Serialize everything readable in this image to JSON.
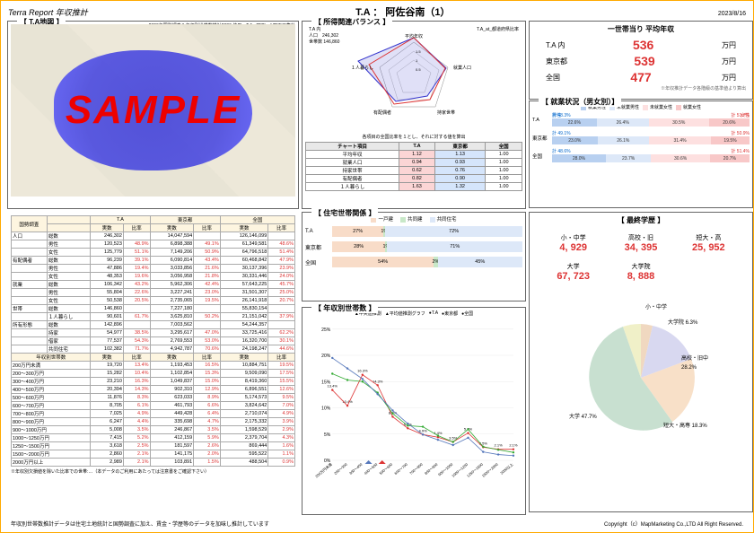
{
  "header": {
    "left": "Terra Report 年収推計",
    "title": "T.A ： 阿佐谷南（1）",
    "date": "2023/8/16"
  },
  "map": {
    "title": "【 T.A地図 】",
    "note": "2020年国勢調査＆年収別世帯数推計2020 使用　T.A : 円[2km] 町丁目集計",
    "sample": "SAMPLE"
  },
  "balance": {
    "title": "【 所得関連バランス 】",
    "meta1": "各項目…",
    "meta2": "人口　246,302",
    "meta3": "世帯数 146,860",
    "meta4": "T.A 内",
    "legend": "T.A_at_都道府県比率",
    "axes": [
      "平均年収",
      "就業人口",
      "持家世帯",
      "有配偶者",
      "１人暮らし"
    ],
    "note": "各項目の全国比率を１とし、それに対する値を算出",
    "table_head": [
      "チャート項目",
      "T.A",
      "東京都",
      "全国"
    ],
    "rows": [
      {
        "k": "平均年収",
        "a": "1.12",
        "b": "1.13",
        "c": "1.00"
      },
      {
        "k": "就業人口",
        "a": "0.94",
        "b": "0.93",
        "c": "1.00"
      },
      {
        "k": "持家世帯",
        "a": "0.62",
        "b": "0.76",
        "c": "1.00"
      },
      {
        "k": "有配偶者",
        "a": "0.82",
        "b": "0.90",
        "c": "1.00"
      },
      {
        "k": "１人暮らし",
        "a": "1.63",
        "b": "1.32",
        "c": "1.00"
      }
    ]
  },
  "income": {
    "title": "一世帯当り 平均年収",
    "rows": [
      {
        "lbl": "T.A 内",
        "val": "536",
        "u": "万円"
      },
      {
        "lbl": "東京都",
        "val": "539",
        "u": "万円"
      },
      {
        "lbl": "全国",
        "val": "477",
        "u": "万円"
      }
    ],
    "note": "※年収推計データ各階級の基準値より算出"
  },
  "emp": {
    "title": "【 就業状況（男女別）】",
    "legend": [
      "就業男性",
      "未就業男性",
      "未就業女性",
      "就業女性"
    ],
    "rows": [
      {
        "area": "T.A",
        "m": "計 48.3%",
        "f": "計 51.7%",
        "vals": [
          "22.6%",
          "26.4%",
          "30.5%",
          "20.6%"
        ]
      },
      {
        "area": "東京都",
        "m": "計 49.1%",
        "f": "計 50.9%",
        "vals": [
          "23.0%",
          "26.1%",
          "31.4%",
          "19.5%"
        ]
      },
      {
        "area": "全国",
        "m": "計 48.6%",
        "f": "計 51.4%",
        "vals": [
          "28.0%",
          "23.7%",
          "30.6%",
          "20.7%"
        ]
      }
    ],
    "hdrs": [
      "男性",
      "女性"
    ]
  },
  "census": {
    "sec1": "国勢調査",
    "sec2": "年収別世帯数",
    "head": [
      "",
      "",
      "T.A",
      "",
      "東京都",
      "",
      "全国",
      ""
    ],
    "head2": [
      "",
      "",
      "実数",
      "比率",
      "実数",
      "比率",
      "実数",
      "比率"
    ],
    "rows": [
      [
        "人口",
        "総数",
        "246,302",
        "",
        "14,047,594",
        "",
        "126,146,099",
        ""
      ],
      [
        "",
        "男性",
        "120,523",
        "48.9%",
        "6,898,388",
        "49.1%",
        "61,349,581",
        "48.6%"
      ],
      [
        "",
        "女性",
        "125,779",
        "51.1%",
        "7,149,206",
        "50.9%",
        "64,796,518",
        "51.4%"
      ],
      [
        "有配偶者",
        "総数",
        "96,239",
        "39.1%",
        "6,090,814",
        "43.4%",
        "60,468,842",
        "47.9%"
      ],
      [
        "",
        "男性",
        "47,886",
        "19.4%",
        "3,033,856",
        "21.6%",
        "30,137,396",
        "23.9%"
      ],
      [
        "",
        "女性",
        "48,353",
        "19.6%",
        "3,056,958",
        "21.8%",
        "30,331,446",
        "24.0%"
      ],
      [
        "就業",
        "総数",
        "106,342",
        "43.2%",
        "5,962,306",
        "42.4%",
        "57,643,225",
        "45.7%"
      ],
      [
        "",
        "男性",
        "55,804",
        "22.6%",
        "3,227,241",
        "23.0%",
        "31,501,307",
        "25.0%"
      ],
      [
        "",
        "女性",
        "50,538",
        "20.5%",
        "2,735,065",
        "19.5%",
        "26,141,918",
        "20.7%"
      ],
      [
        "世帯",
        "総数",
        "146,860",
        "",
        "7,227,180",
        "",
        "55,830,154",
        ""
      ],
      [
        "",
        "１人暮らし",
        "90,601",
        "61.7%",
        "3,625,810",
        "50.2%",
        "21,151,042",
        "37.9%"
      ],
      [
        "所有形態",
        "総数",
        "142,896",
        "",
        "7,003,562",
        "",
        "54,244,357",
        ""
      ],
      [
        "",
        "持家",
        "54,977",
        "38.5%",
        "3,295,617",
        "47.0%",
        "33,725,416",
        "62.2%"
      ],
      [
        "",
        "借家",
        "77,537",
        "54.3%",
        "2,769,553",
        "53.0%",
        "16,320,700",
        "30.1%"
      ],
      [
        "",
        "共同住宅",
        "102,382",
        "71.7%",
        "4,942,787",
        "70.6%",
        "24,198,247",
        "44.6%"
      ]
    ],
    "inc_head": [
      "年収別世帯数",
      "実数",
      "比率",
      "実数",
      "比率",
      "実数",
      "比率"
    ],
    "inc_rows": [
      [
        "200万円未満",
        "19,720",
        "13.4%",
        "1,193,453",
        "16.5%",
        "10,884,751",
        "19.5%"
      ],
      [
        "200～300万円",
        "15,282",
        "10.4%",
        "1,102,854",
        "15.3%",
        "9,509,090",
        "17.5%"
      ],
      [
        "300～400万円",
        "23,210",
        "16.3%",
        "1,049,837",
        "15.0%",
        "8,419,360",
        "15.5%"
      ],
      [
        "400～500万円",
        "20,394",
        "14.3%",
        "902,310",
        "12.9%",
        "6,896,551",
        "12.6%"
      ],
      [
        "500～600万円",
        "11,876",
        "8.3%",
        "623,033",
        "8.9%",
        "5,174,573",
        "9.5%"
      ],
      [
        "600～700万円",
        "8,705",
        "6.1%",
        "461,793",
        "6.6%",
        "3,824,642",
        "7.0%"
      ],
      [
        "700～800万円",
        "7,025",
        "4.9%",
        "449,428",
        "6.4%",
        "2,710,074",
        "4.9%"
      ],
      [
        "800～900万円",
        "6,247",
        "4.4%",
        "335,698",
        "4.7%",
        "2,175,332",
        "3.9%"
      ],
      [
        "900～1000万円",
        "5,008",
        "3.5%",
        "246,867",
        "3.5%",
        "1,598,529",
        "2.9%"
      ],
      [
        "1000～1250万円",
        "7,415",
        "5.2%",
        "412,159",
        "5.9%",
        "2,379,704",
        "4.3%"
      ],
      [
        "1250～1500万円",
        "3,618",
        "2.5%",
        "181,597",
        "2.6%",
        "869,444",
        "1.6%"
      ],
      [
        "1500～2000万円",
        "2,860",
        "2.1%",
        "141,175",
        "2.0%",
        "595,522",
        "1.1%"
      ],
      [
        "2000万円以上",
        "2,989",
        "2.1%",
        "103,891",
        "1.5%",
        "488,504",
        "0.9%"
      ]
    ],
    "note": "※年収別欠損値を除いた比率での世帯:…（本データのご利用にあたっては注意書をご確認下さい）",
    "foot": "年収別世帯数推計データは住宅土地統計と国勢調査に加え、賃金・学歴等のデータを加味し推計しています"
  },
  "house": {
    "title": "【 住宅世帯関係 】",
    "legend": [
      "一戸建",
      "共同建",
      "共同住宅"
    ],
    "rows": [
      {
        "lbl": "T.A",
        "vals": [
          27,
          1,
          72
        ]
      },
      {
        "lbl": "東京都",
        "vals": [
          28,
          1,
          71
        ]
      },
      {
        "lbl": "全国",
        "vals": [
          54,
          2,
          45
        ]
      }
    ]
  },
  "dist": {
    "title": "【 年収別世帯数 】",
    "legend": [
      "中央値推測",
      "平均値推測グラフ",
      "T.A",
      "東京都",
      "全国"
    ]
  },
  "edu": {
    "title": "【 最終学歴 】",
    "cells": [
      {
        "l": "小・中学",
        "v": "4, 929"
      },
      {
        "l": "高校・旧",
        "v": "34, 395"
      },
      {
        "l": "短大・高",
        "v": "25, 952"
      },
      {
        "l": "大学",
        "v": "67, 723"
      },
      {
        "l": "大学院",
        "v": "8, 888"
      }
    ],
    "pie_labels": [
      "小・中学",
      "大学院 6.3%",
      "高校・旧中",
      "大学 47.7%",
      "短大・高専 18.3%"
    ]
  },
  "footer": {
    "copyright": "Copyright（c）MapMarketing Co.,LTD All Right Reserved."
  },
  "chart_data": [
    {
      "type": "radar",
      "categories": [
        "平均年収",
        "就業人口",
        "持家世帯",
        "有配偶者",
        "１人暮らし"
      ],
      "series": [
        {
          "name": "T.A",
          "values": [
            1.12,
            0.94,
            0.62,
            0.82,
            1.63
          ]
        },
        {
          "name": "東京都",
          "values": [
            1.13,
            0.93,
            0.76,
            0.9,
            1.32
          ]
        },
        {
          "name": "全国",
          "values": [
            1.0,
            1.0,
            1.0,
            1.0,
            1.0
          ]
        }
      ],
      "title": "所得関連バランス"
    },
    {
      "type": "bar",
      "title": "就業状況（男女別）",
      "categories": [
        "T.A",
        "東京都",
        "全国"
      ],
      "series": [
        {
          "name": "就業男性",
          "values": [
            22.6,
            23.0,
            28.0
          ]
        },
        {
          "name": "未就業男性",
          "values": [
            26.4,
            26.1,
            23.7
          ]
        },
        {
          "name": "未就業女性",
          "values": [
            30.5,
            31.4,
            30.6
          ]
        },
        {
          "name": "就業女性",
          "values": [
            20.6,
            19.5,
            20.7
          ]
        }
      ]
    },
    {
      "type": "bar",
      "title": "住宅世帯関係",
      "categories": [
        "T.A",
        "東京都",
        "全国"
      ],
      "series": [
        {
          "name": "一戸建",
          "values": [
            27,
            28,
            54
          ]
        },
        {
          "name": "共同建",
          "values": [
            1,
            1,
            2
          ]
        },
        {
          "name": "共同住宅",
          "values": [
            72,
            71,
            45
          ]
        }
      ]
    },
    {
      "type": "line",
      "title": "年収別世帯数",
      "x": [
        "200万円未満",
        "200～300",
        "300～400",
        "400～500",
        "500～600",
        "600～700",
        "700～800",
        "800～900",
        "900～1000",
        "1000～1250",
        "1250～1500",
        "1500～2000",
        "2000以上"
      ],
      "series": [
        {
          "name": "T.A",
          "values": [
            13.4,
            10.4,
            16.3,
            14.3,
            8.3,
            6.1,
            4.9,
            4.4,
            3.5,
            5.2,
            2.5,
            2.1,
            2.1
          ]
        },
        {
          "name": "東京都",
          "values": [
            16.5,
            15.3,
            15.0,
            12.9,
            8.9,
            6.6,
            6.4,
            4.7,
            3.5,
            5.9,
            2.6,
            2.0,
            1.5
          ]
        },
        {
          "name": "全国",
          "values": [
            19.5,
            17.5,
            15.5,
            12.6,
            9.5,
            7.0,
            4.9,
            3.9,
            2.9,
            4.3,
            1.6,
            1.1,
            0.9
          ]
        }
      ],
      "ylabel": "%",
      "ylim": [
        0,
        25
      ]
    },
    {
      "type": "pie",
      "title": "最終学歴",
      "categories": [
        "小・中学",
        "高校・旧中",
        "短大・高専",
        "大学",
        "大学院"
      ],
      "values": [
        4929,
        34395,
        25952,
        67723,
        8888
      ]
    }
  ]
}
